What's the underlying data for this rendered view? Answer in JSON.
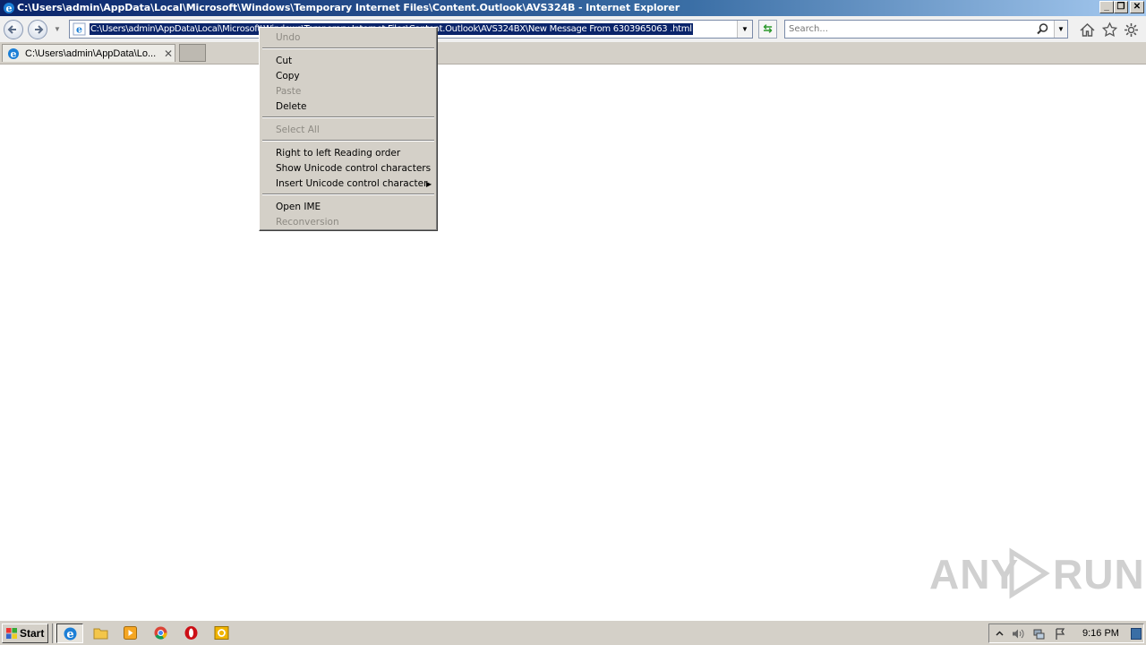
{
  "window": {
    "title": "C:\\Users\\admin\\AppData\\Local\\Microsoft\\Windows\\Temporary Internet Files\\Content.Outlook\\AVS324B - Internet Explorer",
    "minimize": "_",
    "restore": "❐",
    "close": "✕"
  },
  "toolbar": {
    "address_value": "C:\\Users\\admin\\AppData\\Local\\Microsoft\\Windows\\Temporary Internet Files\\Content.Outlook\\AVS324BX\\New Message From 6303965063  .html",
    "search_placeholder": "Search...",
    "dropdown_glyph": "▼"
  },
  "tabs": [
    {
      "label": "C:\\Users\\admin\\AppData\\Lo...",
      "close": "✕"
    }
  ],
  "context_menu": {
    "items": [
      {
        "label": "Undo",
        "enabled": false
      },
      {
        "label": "Cut",
        "enabled": true
      },
      {
        "label": "Copy",
        "enabled": true
      },
      {
        "label": "Paste",
        "enabled": false
      },
      {
        "label": "Delete",
        "enabled": true
      },
      {
        "label": "Select All",
        "enabled": false
      },
      {
        "label": "Right to left Reading order",
        "enabled": true
      },
      {
        "label": "Show Unicode control characters",
        "enabled": true
      },
      {
        "label": "Insert Unicode control character",
        "enabled": true,
        "submenu": true
      },
      {
        "label": "Open IME",
        "enabled": true
      },
      {
        "label": "Reconversion",
        "enabled": false
      }
    ],
    "submenu_arrow": "▶"
  },
  "watermark": {
    "left": "ANY",
    "right": "RUN"
  },
  "taskbar": {
    "start_label": "Start",
    "apps": [
      "internet-explorer",
      "explorer",
      "media-player",
      "chrome",
      "opera",
      "outlook"
    ],
    "clock": "9:16 PM"
  },
  "colors": {
    "title_gradient_start": "#0a246a",
    "selection": "#0a246a",
    "chrome_face": "#d4d0c8"
  }
}
